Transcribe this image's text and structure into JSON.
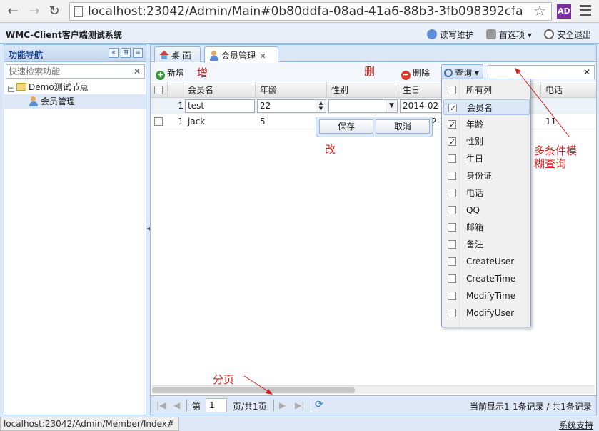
{
  "browser": {
    "back": "←",
    "forward": "→",
    "reload": "↻",
    "url": "localhost:23042/Admin/Main#0b80ddfa-08ad-41a6-88b3-3fb098392cfa",
    "star": "☆",
    "ext": "AD"
  },
  "header": {
    "title": "WMC-Client客户端测试系统",
    "links": [
      "读写维护",
      "首选项 ▾",
      "安全退出"
    ]
  },
  "sidebar": {
    "title": "功能导航",
    "search_placeholder": "快速检索功能",
    "clear": "✕",
    "tree": [
      {
        "toggle": "−",
        "label": "Demo测试节点"
      },
      {
        "label": "会员管理"
      }
    ]
  },
  "tabs": [
    {
      "label": "桌 面"
    },
    {
      "label": "会员管理",
      "close": "✕"
    }
  ],
  "toolbar": {
    "add": "新增",
    "delete": "删除",
    "query": "查询 ▾",
    "query_clear": "✕"
  },
  "grid": {
    "columns": [
      "会员名",
      "年龄",
      "性别",
      "生日",
      "电话"
    ],
    "edit_row": {
      "num": "1",
      "name": "test",
      "age": "22",
      "gender": "",
      "birthday": "2014-02-1"
    },
    "rows": [
      {
        "num": "1",
        "name": "jack",
        "age": "5",
        "birthday_tail": "2-1",
        "phone": "11"
      }
    ],
    "save": "保存",
    "cancel": "取消"
  },
  "column_menu": [
    {
      "label": "所有列",
      "checked": false
    },
    {
      "label": "会员名",
      "checked": true
    },
    {
      "label": "年龄",
      "checked": true
    },
    {
      "label": "性别",
      "checked": true
    },
    {
      "label": "生日",
      "checked": false
    },
    {
      "label": "身份证",
      "checked": false
    },
    {
      "label": "电话",
      "checked": false
    },
    {
      "label": "QQ",
      "checked": false
    },
    {
      "label": "邮箱",
      "checked": false
    },
    {
      "label": "备注",
      "checked": false
    },
    {
      "label": "CreateUser",
      "checked": false
    },
    {
      "label": "CreateTime",
      "checked": false
    },
    {
      "label": "ModifyTime",
      "checked": false
    },
    {
      "label": "ModifyUser",
      "checked": false
    }
  ],
  "pager": {
    "page_label": "第",
    "page_value": "1",
    "page_of": "页/共1页",
    "summary": "当前显示1-1条记录 / 共1条记录"
  },
  "annotations": {
    "add": "增",
    "delete": "删",
    "edit": "改",
    "query": "多条件模\n糊查询",
    "paging": "分页"
  },
  "status": {
    "url": "localhost:23042/Admin/Member/Index#",
    "support": "系统支持"
  },
  "colors": {
    "accent": "#99bbe8",
    "annotation": "#d42020"
  }
}
